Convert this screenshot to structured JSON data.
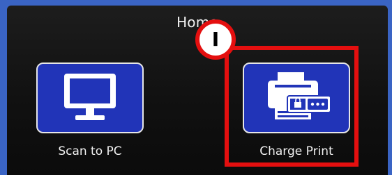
{
  "screen": {
    "title": "Home"
  },
  "apps": [
    {
      "label": "Scan to PC",
      "icon": "monitor-icon"
    },
    {
      "label": "Charge Print",
      "icon": "secure-printer-icon"
    }
  ],
  "annotation": {
    "step_label": "I",
    "highlight_color": "#e40f0f"
  },
  "colors": {
    "tile_blue": "#2134b8",
    "frame_blue": "#3a64c4",
    "screen_black": "#111111"
  }
}
